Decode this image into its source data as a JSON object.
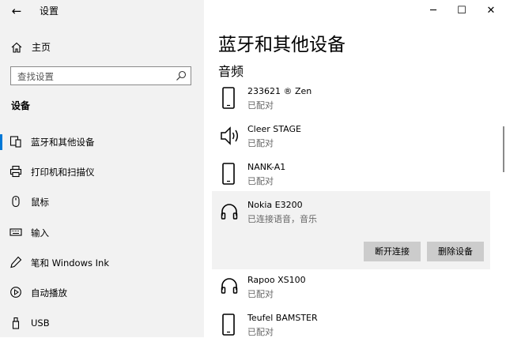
{
  "app": {
    "title": "设置",
    "back_glyph": "←"
  },
  "window_controls": {
    "minimize": "─",
    "maximize": "☐",
    "close": "✕"
  },
  "sidebar": {
    "home": "主页",
    "search_placeholder": "查找设置",
    "section": "设备",
    "items": [
      {
        "label": "蓝牙和其他设备",
        "icon": "bluetooth-devices-icon",
        "active": true
      },
      {
        "label": "打印机和扫描仪",
        "icon": "printer-icon",
        "active": false
      },
      {
        "label": "鼠标",
        "icon": "mouse-icon",
        "active": false
      },
      {
        "label": "输入",
        "icon": "keyboard-icon",
        "active": false
      },
      {
        "label": "笔和 Windows Ink",
        "icon": "pen-icon",
        "active": false
      },
      {
        "label": "自动播放",
        "icon": "autoplay-icon",
        "active": false
      },
      {
        "label": "USB",
        "icon": "usb-icon",
        "active": false
      }
    ]
  },
  "main": {
    "title": "蓝牙和其他设备",
    "subheading": "音频",
    "devices": [
      {
        "name": "233621 ® Zen",
        "status": "已配对",
        "icon": "phone-icon"
      },
      {
        "name": "Cleer STAGE",
        "status": "已配对",
        "icon": "speaker-icon"
      },
      {
        "name": "NANK-A1",
        "status": "已配对",
        "icon": "phone-icon"
      },
      {
        "name": "Nokia E3200",
        "status": "已连接语音，音乐",
        "icon": "headphones-icon",
        "selected": true
      },
      {
        "name": "Rapoo XS100",
        "status": "已配对",
        "icon": "headphones-icon"
      },
      {
        "name": "Teufel BAMSTER",
        "status": "已配对",
        "icon": "phone-icon"
      }
    ],
    "buttons": {
      "disconnect": "断开连接",
      "remove": "删除设备"
    }
  },
  "colors": {
    "accent": "#0078d7",
    "sidebar_bg": "#f2f2f2",
    "button_bg": "#cccccc"
  }
}
